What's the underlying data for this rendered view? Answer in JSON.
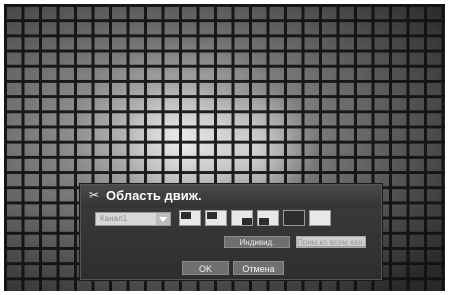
{
  "dialog": {
    "title": "Область движ.",
    "title_icon": "motion-area-icon",
    "channel_select": {
      "value": "Канал1"
    },
    "layouts": [
      {
        "name": "layout-top-left"
      },
      {
        "name": "layout-top-right"
      },
      {
        "name": "layout-bottom-left"
      },
      {
        "name": "layout-bottom-right"
      },
      {
        "name": "layout-full"
      },
      {
        "name": "layout-empty"
      }
    ],
    "individual_button": "Индивид.",
    "apply_all_button": "Прим.ко всем кан.",
    "ok_button": "OK",
    "cancel_button": "Отмена"
  },
  "colors": {
    "dialog_bg": "#333333",
    "grid_line": "#111111",
    "grid_cell": "#ffffff"
  }
}
